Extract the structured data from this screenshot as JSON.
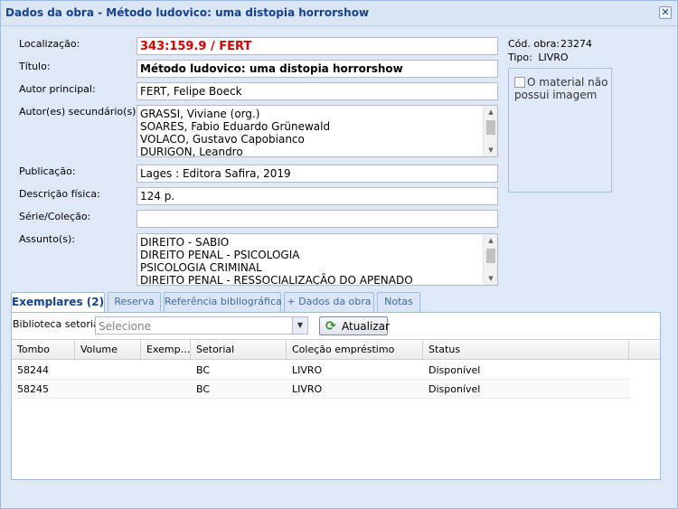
{
  "window": {
    "title": "Dados da obra - Método ludovico: uma distopia horrorshow",
    "close_symbol": "✕"
  },
  "fields": {
    "localizacao_label": "Localização:",
    "localizacao_value": "343:159.9 / FERT",
    "titulo_label": "Título:",
    "titulo_value": "Método ludovico: uma distopia horrorshow",
    "autor_label": "Autor principal:",
    "autor_value": "FERT, Felipe Boeck",
    "autores_sec_label": "Autor(es) secundário(s):",
    "autores_sec_values": [
      "GRASSI, Viviane (org.)",
      "SOARES, Fabio Eduardo Grünewald",
      "VOLACO, Gustavo Capobianco",
      "DURIGON, Leandro"
    ],
    "publicacao_label": "Publicação:",
    "publicacao_value": "Lages : Editora Safira, 2019",
    "descricao_label": "Descrição física:",
    "descricao_value": "124 p.",
    "serie_label": "Série/Coleção:",
    "serie_value": "",
    "assunto_label": "Assunto(s):",
    "assunto_values": [
      "DIREITO - SABIO",
      "DIREITO PENAL - PSICOLOGIA",
      "PSICOLOGIA CRIMINAL",
      "DIREITO PENAL - RESSOCIALIZAÇÃO DO APENADO"
    ]
  },
  "meta": {
    "cod_label": "Cód. obra:",
    "cod_value": "23274",
    "tipo_label": "Tipo:",
    "tipo_value": "LIVRO",
    "image_alt": "O material não possui imagem"
  },
  "tabs": [
    {
      "label": "Exemplares (2)",
      "active": true
    },
    {
      "label": "Reserva",
      "active": false
    },
    {
      "label": "Referência bibliográfica",
      "active": false
    },
    {
      "label": "+ Dados da obra",
      "active": false
    },
    {
      "label": "Notas",
      "active": false
    }
  ],
  "toolbar": {
    "biblioteca_label": "Biblioteca setorial:",
    "biblioteca_placeholder": "Selecione",
    "atualizar_label": "Atualizar"
  },
  "grid": {
    "columns": [
      "Tombo",
      "Volume",
      "Exemp…",
      "Setorial",
      "Coleção empréstimo",
      "Status"
    ],
    "rows": [
      [
        "58244",
        "",
        "",
        "BC",
        "LIVRO",
        "Disponível"
      ],
      [
        "58245",
        "",
        "",
        "BC",
        "LIVRO",
        "Disponível"
      ]
    ]
  },
  "colors": {
    "accent": "#15428b",
    "localizacao_text": "#dd0000",
    "window_bg": "#dfe8f6",
    "refresh_icon": "#2e8b2e"
  },
  "icons": {
    "close": "close-icon",
    "refresh": "refresh-icon",
    "combo_trigger": "chevron-down-icon",
    "broken_image": "broken-image-icon"
  }
}
